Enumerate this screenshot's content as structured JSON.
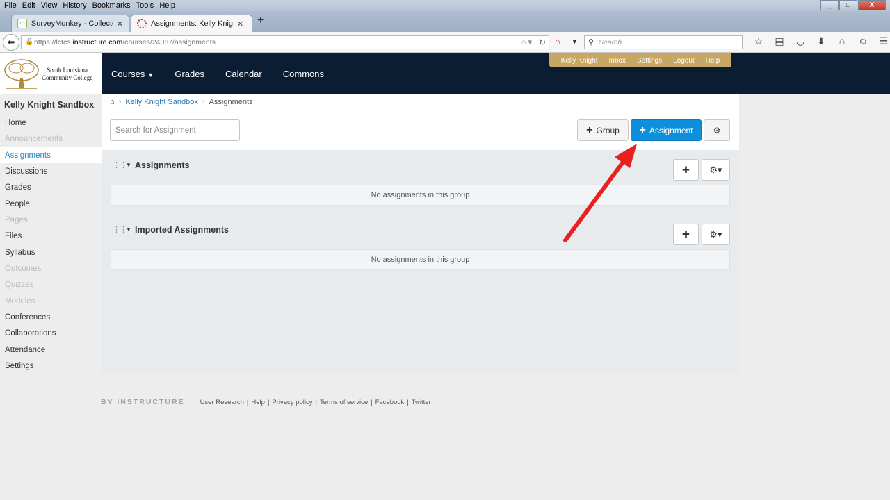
{
  "browser": {
    "menu": [
      "File",
      "Edit",
      "View",
      "History",
      "Bookmarks",
      "Tools",
      "Help"
    ],
    "tabs": [
      {
        "title": "SurveyMonkey - Collector ...",
        "icon": "surveymonkey-icon"
      },
      {
        "title": "Assignments: Kelly Knight ...",
        "icon": "canvas-icon"
      }
    ],
    "url_prefix": "https://lctcs.",
    "url_host": "instructure.com",
    "url_path": "/courses/24067/assignments",
    "search_placeholder": "Search",
    "window_controls": [
      "_",
      "□",
      "X"
    ]
  },
  "site": {
    "logo_line1": "South Louisiana",
    "logo_line2": "Community College",
    "global_nav": [
      "Courses",
      "Grades",
      "Calendar",
      "Commons"
    ],
    "user_nav": [
      "Kelly Knight",
      "Inbox",
      "Settings",
      "Logout",
      "Help"
    ]
  },
  "course": {
    "title": "Kelly Knight Sandbox",
    "nav": [
      {
        "label": "Home",
        "state": "normal"
      },
      {
        "label": "Announcements",
        "state": "disabled"
      },
      {
        "label": "Assignments",
        "state": "active"
      },
      {
        "label": "Discussions",
        "state": "normal"
      },
      {
        "label": "Grades",
        "state": "normal"
      },
      {
        "label": "People",
        "state": "normal"
      },
      {
        "label": "Pages",
        "state": "disabled"
      },
      {
        "label": "Files",
        "state": "normal"
      },
      {
        "label": "Syllabus",
        "state": "normal"
      },
      {
        "label": "Outcomes",
        "state": "disabled"
      },
      {
        "label": "Quizzes",
        "state": "disabled"
      },
      {
        "label": "Modules",
        "state": "disabled"
      },
      {
        "label": "Conferences",
        "state": "normal"
      },
      {
        "label": "Collaborations",
        "state": "normal"
      },
      {
        "label": "Attendance",
        "state": "normal"
      },
      {
        "label": "Settings",
        "state": "normal"
      }
    ]
  },
  "breadcrumb": {
    "course": "Kelly Knight Sandbox",
    "page": "Assignments"
  },
  "toolbar": {
    "search_placeholder": "Search for Assignment",
    "group_label": "Group",
    "assignment_label": "Assignment"
  },
  "groups": [
    {
      "name": "Assignments",
      "empty": "No assignments in this group"
    },
    {
      "name": "Imported Assignments",
      "empty": "No assignments in this group"
    }
  ],
  "footer": {
    "brand": "BY INSTRUCTURE",
    "links": [
      "User Research",
      "Help",
      "Privacy policy",
      "Terms of service",
      "Facebook",
      "Twitter"
    ]
  },
  "colors": {
    "primary": "#0e8fdc",
    "header": "#0b1d33",
    "usernav": "#c8a664",
    "annotation_arrow": "#e8201e"
  }
}
